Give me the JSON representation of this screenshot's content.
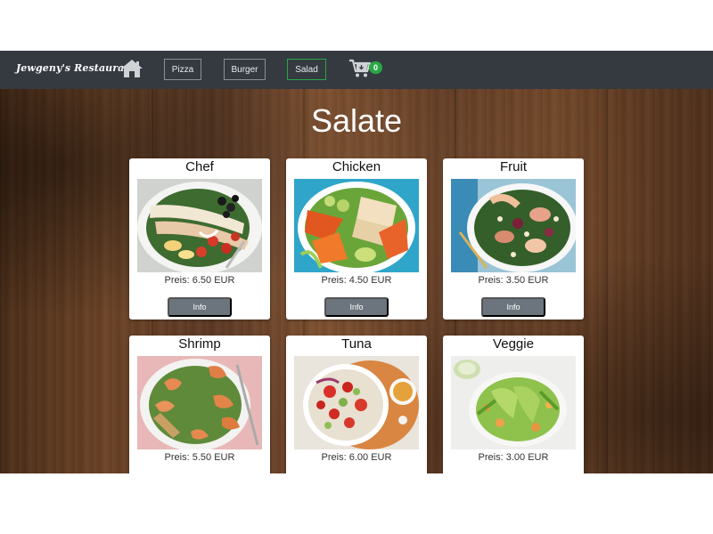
{
  "brand": "Jewgeny's Restaurant",
  "nav": {
    "buttons": [
      {
        "label": "Pizza",
        "active": false
      },
      {
        "label": "Burger",
        "active": false
      },
      {
        "label": "Salad",
        "active": true
      }
    ],
    "cart_count": "0"
  },
  "page": {
    "title": "Salate"
  },
  "price_prefix": "Preis:",
  "items": [
    {
      "name": "Chef",
      "price": "6.50 EUR",
      "info_label": "Info",
      "image": "chef-salad-photo"
    },
    {
      "name": "Chicken",
      "price": "4.50 EUR",
      "info_label": "Info",
      "image": "chicken-salad-photo"
    },
    {
      "name": "Fruit",
      "price": "3.50 EUR",
      "info_label": "Info",
      "image": "fruit-salad-photo"
    },
    {
      "name": "Shrimp",
      "price": "5.50 EUR",
      "image": "shrimp-salad-photo"
    },
    {
      "name": "Tuna",
      "price": "6.00 EUR",
      "image": "tuna-salad-photo"
    },
    {
      "name": "Veggie",
      "price": "3.00 EUR",
      "image": "veggie-salad-photo"
    }
  ],
  "colors": {
    "navbar": "#343a40",
    "active_border": "#28a745",
    "badge": "#28a745",
    "info_button": "#6c757d"
  }
}
